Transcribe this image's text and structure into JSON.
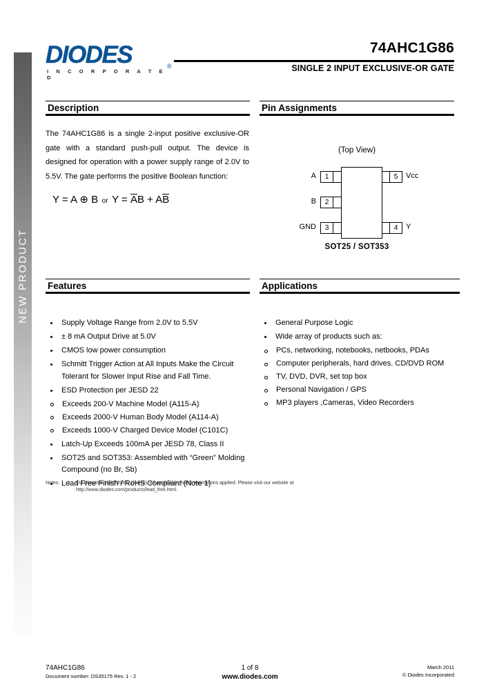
{
  "sidebar": {
    "label": "NEW PRODUCT"
  },
  "header": {
    "logo_word": "DIODES",
    "logo_sub": "I N C O R P O R A T E D",
    "logo_reg": "®",
    "part_number": "74AHC1G86",
    "part_subtitle": "SINGLE 2 INPUT EXCLUSIVE-OR GATE"
  },
  "description": {
    "title": "Description",
    "body": "The 74AHC1G86 is a single 2-input positive exclusive-OR gate with a standard push-pull output. The device is designed for operation with a power supply range of 2.0V to 5.5V. The gate performs the positive Boolean function:",
    "formula": {
      "lhs": "Y = A ⊕ B",
      "conj": "or",
      "rhs_prefix": "Y = ",
      "term1_bar": "A",
      "term1_plain": "B",
      "plus": " + ",
      "term2_plain": "A",
      "term2_bar": "B"
    }
  },
  "pin_assignments": {
    "title": "Pin Assignments",
    "view_label": "(Top View)",
    "package": "SOT25 / SOT353",
    "left_pins": [
      {
        "number": "1",
        "label": "A"
      },
      {
        "number": "2",
        "label": "B"
      },
      {
        "number": "3",
        "label": "GND"
      }
    ],
    "right_pins": [
      {
        "number": "5",
        "label": "Vcc"
      },
      {
        "number": "4",
        "label": "Y"
      }
    ]
  },
  "features": {
    "title": "Features",
    "items": [
      {
        "text": "Supply Voltage Range from 2.0V  to 5.5V"
      },
      {
        "text": "± 8 mA Output Drive at 5.0V"
      },
      {
        "text": "CMOS low power consumption"
      },
      {
        "text": "Schmitt Trigger Action at All Inputs Make the Circuit Tolerant for Slower Input Rise and Fall Time."
      },
      {
        "text": "ESD Protection per JESD 22",
        "sub": [
          "Exceeds 200-V Machine Model (A115-A)",
          "Exceeds 2000-V Human Body Model (A114-A)",
          "Exceeds 1000-V Charged Device Model (C101C)"
        ]
      },
      {
        "text": "Latch-Up Exceeds 100mA per JESD 78, Class II"
      },
      {
        "text": "SOT25 and SOT353: Assembled with “Green” Molding Compound (no Br, Sb)"
      },
      {
        "text": "Lead Free Finish / RoHS Compliant (Note 1)"
      }
    ]
  },
  "applications": {
    "title": "Applications",
    "items": [
      {
        "text": "General Purpose Logic"
      },
      {
        "text": "Wide array of products such as:",
        "sub": [
          "PCs, networking, notebooks, netbooks, PDAs",
          "Computer peripherals, hard drives. CD/DVD ROM",
          "TV, DVD, DVR, set top box",
          "Personal Navigation / GPS",
          "MP3 players ,Cameras, Video Recorders"
        ]
      }
    ]
  },
  "notes": {
    "label": "Notes:",
    "number": "1.",
    "line1": "EU Directive 2002/95/EC (RoHS). All applicable RoHS exemptions applied. Please visit our website at",
    "line2": "http://www.diodes.com/products/lead_free.html."
  },
  "footer": {
    "left_line1": "74AHC1G86",
    "left_line2": "Document number: DS35175 Rev. 1 - 2",
    "center_line1": "1 of 8",
    "center_line2": "www.diodes.com",
    "right_line1": "March 2011",
    "right_line2": "© Diodes Incorporated"
  },
  "colors": {
    "brand_blue": "#0b5394",
    "rule": "#000000"
  }
}
